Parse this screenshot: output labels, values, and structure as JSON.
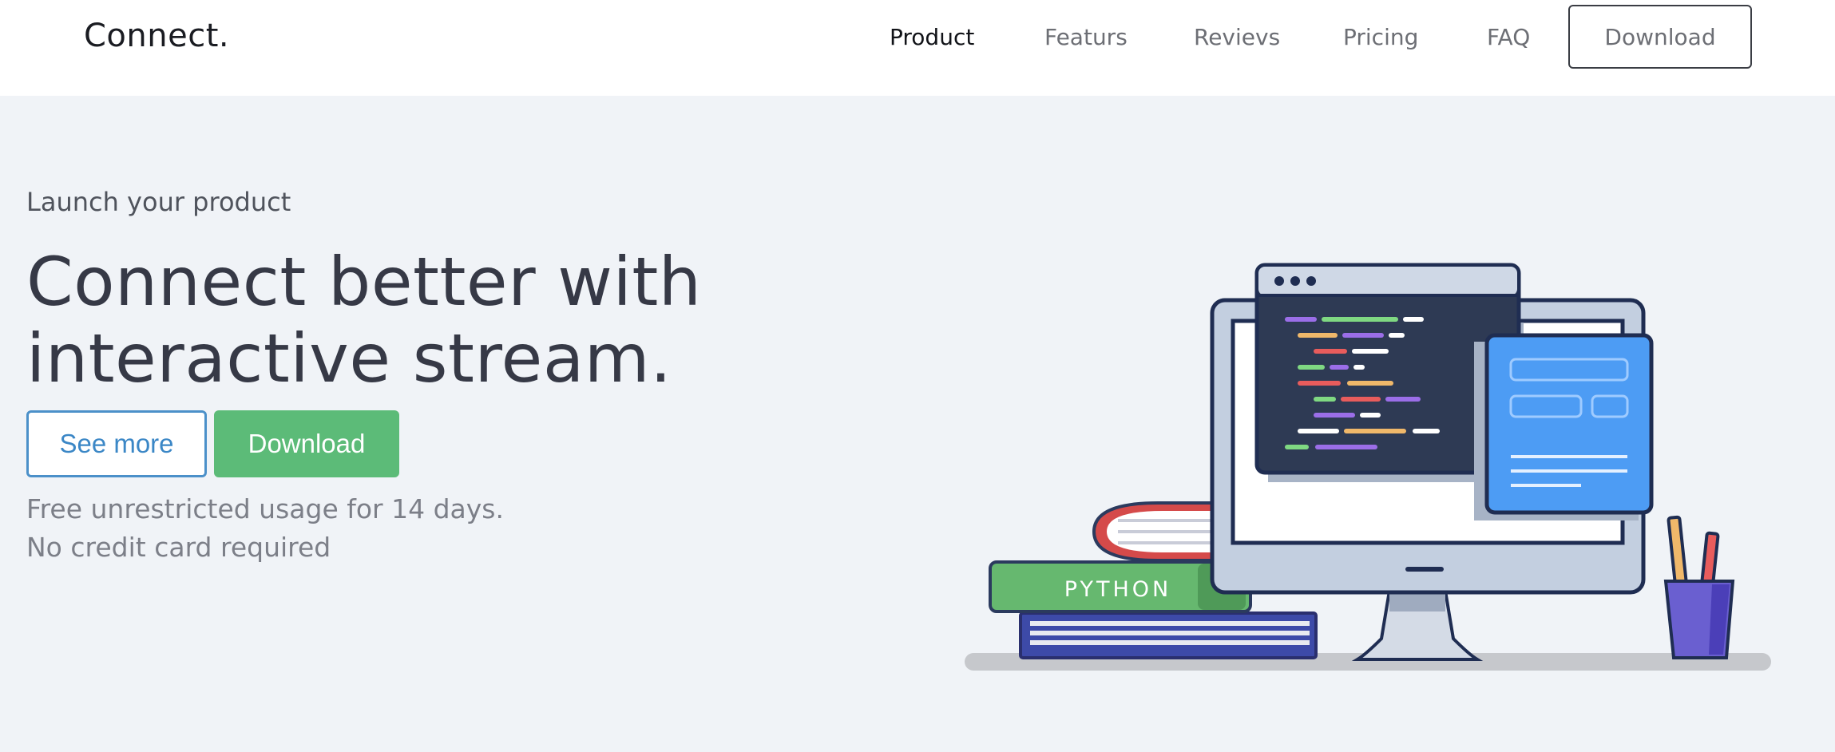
{
  "navbar": {
    "brand": "Connect.",
    "links": [
      "Product",
      "Featurs",
      "Revievs",
      "Pricing",
      "FAQ"
    ],
    "download_label": "Download"
  },
  "hero": {
    "eyebrow": "Launch your product",
    "title_line1": "Connect better with",
    "title_line2": "interactive stream.",
    "see_more_label": "See more",
    "download_label": "Download",
    "note_line1": "Free unrestricted usage for 14 days.",
    "note_line2": "No credit card required"
  },
  "illustration": {
    "book_label": "PYTHON"
  },
  "colors": {
    "background": "#f0f3f7",
    "primary_green": "#5cbb78",
    "accent_blue": "#4b90c9",
    "text_dark": "#363946"
  }
}
